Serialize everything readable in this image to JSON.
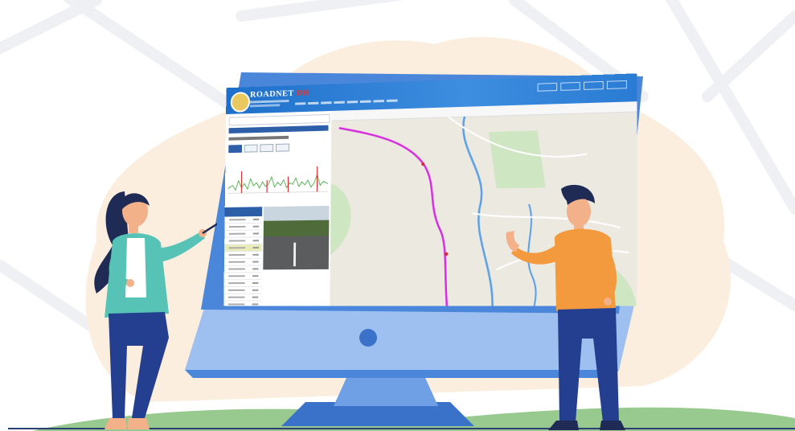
{
  "app": {
    "logo_text_primary": "ROADNET",
    "logo_text_secondary": "DH"
  },
  "colors": {
    "monitor_frame": "#4a86d9",
    "monitor_stand": "#6fa0e6",
    "blob": "#fbeede",
    "route": "#d62de0",
    "river": "#5aa0e8",
    "park": "#cfe6c3",
    "grass": "#86c07a"
  },
  "icons": {
    "woman": "presenter-woman",
    "man": "presenter-man",
    "pointer": "pointer-stick",
    "camera": "webcam-dot"
  }
}
